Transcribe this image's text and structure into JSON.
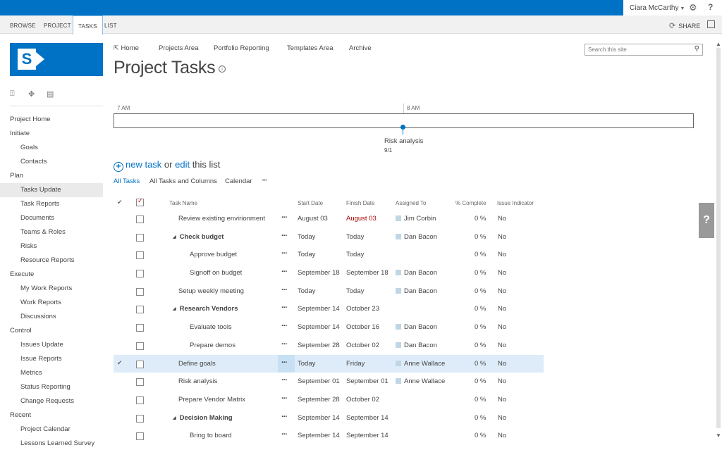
{
  "suite": {
    "user_name": "Ciara McCarthy",
    "help_label": "?"
  },
  "ribbon": {
    "tabs": [
      {
        "label": "BROWSE"
      },
      {
        "label": "PROJECT"
      },
      {
        "label": "TASKS"
      },
      {
        "label": "LIST"
      }
    ],
    "selected_tab": "TASKS",
    "share_label": "SHARE"
  },
  "logo": {
    "letter": "S"
  },
  "leftnav": {
    "items": [
      {
        "label": "Project Home",
        "level": 0
      },
      {
        "label": "Initiate",
        "level": 0
      },
      {
        "label": "Goals",
        "level": 1
      },
      {
        "label": "Contacts",
        "level": 1
      },
      {
        "label": "Plan",
        "level": 0
      },
      {
        "label": "Tasks Update",
        "level": 1,
        "selected": true
      },
      {
        "label": "Task Reports",
        "level": 1
      },
      {
        "label": "Documents",
        "level": 1
      },
      {
        "label": "Teams & Roles",
        "level": 1
      },
      {
        "label": "Risks",
        "level": 1
      },
      {
        "label": "Resource Reports",
        "level": 1
      },
      {
        "label": "Execute",
        "level": 0
      },
      {
        "label": "My Work Reports",
        "level": 1
      },
      {
        "label": "Work Reports",
        "level": 1
      },
      {
        "label": "Discussions",
        "level": 1
      },
      {
        "label": "Control",
        "level": 0
      },
      {
        "label": "Issues Update",
        "level": 1
      },
      {
        "label": "Issue Reports",
        "level": 1
      },
      {
        "label": "Metrics",
        "level": 1
      },
      {
        "label": "Status Reporting",
        "level": 1
      },
      {
        "label": "Change Requests",
        "level": 1
      },
      {
        "label": "Recent",
        "level": 0
      },
      {
        "label": "Project Calendar",
        "level": 1
      },
      {
        "label": "Lessons Learned Survey",
        "level": 1
      }
    ]
  },
  "topnav": {
    "items": [
      "Home",
      "Projects Area",
      "Portfolio Reporting",
      "Templates Area",
      "Archive"
    ]
  },
  "page": {
    "title": "Project Tasks"
  },
  "search": {
    "placeholder": "Search this site"
  },
  "timeline": {
    "start_label": "7 AM",
    "end_label": "8 AM",
    "milestone_task": "Risk analysis",
    "milestone_date": "9/1"
  },
  "newtask": {
    "new_label": "new task",
    "or_label": " or ",
    "edit_label": "edit",
    "tail_label": " this list"
  },
  "views": {
    "items": [
      "All Tasks",
      "All Tasks and Columns",
      "Calendar",
      "•••"
    ],
    "selected": "All Tasks"
  },
  "list": {
    "columns": [
      "Task Name",
      "Start Date",
      "Finish Date",
      "Assigned To",
      "% Complete",
      "Issue Indicator"
    ],
    "rows": [
      {
        "name": "Review existing envirionment",
        "indent": 1,
        "bold": false,
        "start": "August 03",
        "finish": "August 03",
        "finish_late": true,
        "assigned": "Jim Corbin",
        "pct": "0 %",
        "issue": "No"
      },
      {
        "name": "Check budget",
        "indent": 0,
        "bold": true,
        "start": "Today",
        "finish": "Today",
        "assigned": "Dan Bacon",
        "pct": "0 %",
        "issue": "No"
      },
      {
        "name": "Approve budget",
        "indent": 2,
        "bold": false,
        "start": "Today",
        "finish": "Today",
        "assigned": "",
        "pct": "0 %",
        "issue": "No"
      },
      {
        "name": "Signoff on budget",
        "indent": 2,
        "bold": false,
        "start": "September 18",
        "finish": "September 18",
        "assigned": "Dan Bacon",
        "pct": "0 %",
        "issue": "No"
      },
      {
        "name": "Setup weekly meeting",
        "indent": 1,
        "bold": false,
        "start": "Today",
        "finish": "Today",
        "assigned": "Dan Bacon",
        "pct": "0 %",
        "issue": "No"
      },
      {
        "name": "Research Vendors",
        "indent": 0,
        "bold": true,
        "start": "September 14",
        "finish": "October 23",
        "assigned": "",
        "pct": "0 %",
        "issue": "No"
      },
      {
        "name": "Evaluate tools",
        "indent": 2,
        "bold": false,
        "start": "September 14",
        "finish": "October 16",
        "assigned": "Dan Bacon",
        "pct": "0 %",
        "issue": "No"
      },
      {
        "name": "Prepare demos",
        "indent": 2,
        "bold": false,
        "start": "September 28",
        "finish": "October 02",
        "assigned": "Dan Bacon",
        "pct": "0 %",
        "issue": "No"
      },
      {
        "name": "Define goals",
        "indent": 1,
        "bold": false,
        "start": "Today",
        "finish": "Friday",
        "assigned": "Anne Wallace",
        "pct": "0 %",
        "issue": "No",
        "selected": true
      },
      {
        "name": "Risk analysis",
        "indent": 1,
        "bold": false,
        "start": "September 01",
        "finish": "September 01",
        "assigned": "Anne Wallace",
        "pct": "0 %",
        "issue": "No"
      },
      {
        "name": "Prepare Vendor Matrix",
        "indent": 1,
        "bold": false,
        "start": "September 28",
        "finish": "October 02",
        "assigned": "",
        "pct": "0 %",
        "issue": "No"
      },
      {
        "name": "Decision Making",
        "indent": 0,
        "bold": true,
        "start": "September 14",
        "finish": "September 14",
        "assigned": "",
        "pct": "0 %",
        "issue": "No"
      },
      {
        "name": "Bring to board",
        "indent": 2,
        "bold": false,
        "start": "September 14",
        "finish": "September 14",
        "assigned": "",
        "pct": "0 %",
        "issue": "No"
      }
    ]
  },
  "colors": {
    "brand": "#0072c6",
    "late": "#a80000",
    "selected_row": "#deecf9"
  }
}
